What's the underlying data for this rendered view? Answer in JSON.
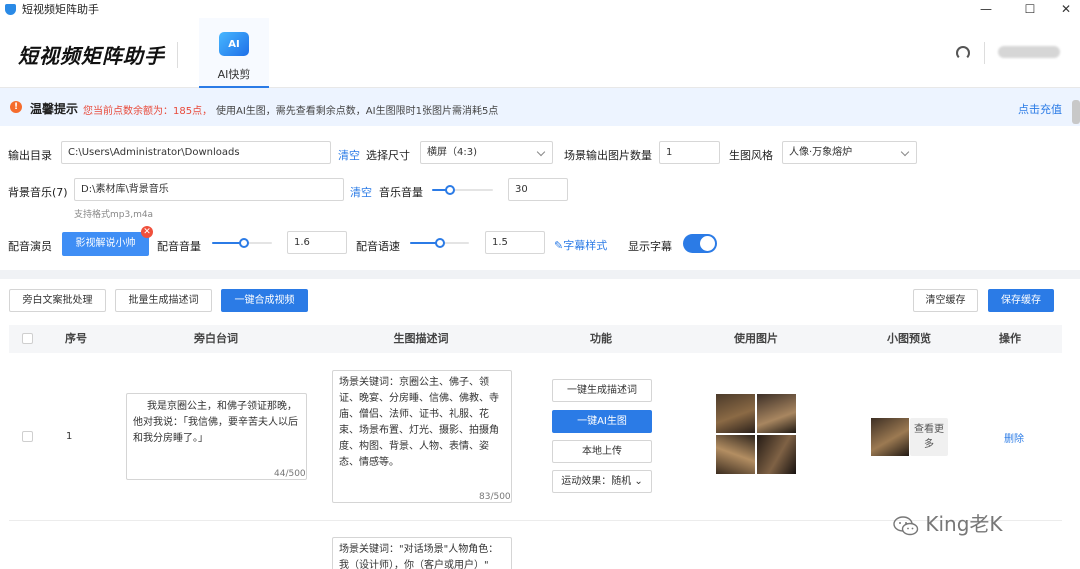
{
  "window": {
    "title": "短视频矩阵助手",
    "minimize": "—",
    "maximize": "☐",
    "close": "✕"
  },
  "header": {
    "logo": "短视频矩阵助手",
    "tab_ai_icon": "AI",
    "tab_ai_label": "AI快剪"
  },
  "notice": {
    "title": "温馨提示",
    "points": "您当前点数余额为：185点，",
    "text": "使用AI生图，需先查看剩余点数，AI生图限时1张图片需消耗5点",
    "recharge": "点击充值"
  },
  "settings": {
    "output_dir_label": "输出目录",
    "output_dir_value": "C:\\Users\\Administrator\\Downloads",
    "clear_label": "清空",
    "size_label": "选择尺寸",
    "size_value": "横屏（4:3)",
    "scene_count_label": "场景输出图片数量",
    "scene_count_value": "1",
    "style_label": "生图风格",
    "style_value": "人像·万象熔炉",
    "bgm_label": "背景音乐(7)",
    "bgm_value": "D:\\素材库\\背景音乐",
    "bgm_clear": "清空",
    "bgm_hint": "支持格式mp3,m4a",
    "music_volume_label": "音乐音量",
    "music_volume_value": "30",
    "music_volume_level": 0.3,
    "voice_actor_label": "配音演员",
    "voice_actor_value": "影视解说小帅",
    "voice_remove": "✕",
    "voice_volume_label": "配音音量",
    "voice_volume_value": "1.6",
    "voice_volume_level": 0.53,
    "voice_speed_label": "配音语速",
    "voice_speed_value": "1.5",
    "voice_speed_level": 0.5,
    "subtitle_style_link": "✎字幕样式",
    "show_subtitle_label": "显示字幕",
    "show_subtitle_on": true
  },
  "toolbar": {
    "batch_narration": "旁白文案批处理",
    "batch_describe": "批量生成描述词",
    "compose_video": "一键合成视频",
    "clear_cache": "清空缓存",
    "save_cache": "保存缓存"
  },
  "table": {
    "headers": [
      "序号",
      "旁白台词",
      "生图描述词",
      "功能",
      "使用图片",
      "小图预览",
      "操作"
    ],
    "rows": [
      {
        "index": "1",
        "narration": "我是京圈公主，和佛子领证那晚，他对我说：「我信佛，要辛苦夫人以后和我分房睡了。」",
        "narration_count": "44/500",
        "description": "场景关键词：京圈公主、佛子、领证、晚宴、分房睡、信佛、佛教、寺庙、僧侣、法师、证书、礼服、花束、场景布置、灯光、摄影、拍摄角度、构图、背景、人物、表情、姿态、情感等。",
        "description_count": "83/500",
        "fn_describe": "一键生成描述词",
        "fn_ai_image": "一键AI生图",
        "fn_upload": "本地上传",
        "fn_motion": "运动效果：随机",
        "view_more": "查看更多",
        "delete": "删除"
      },
      {
        "description": "场景关键词：\"对话场景\"人物角色：我（设计师），你（客户或用户）\""
      }
    ]
  },
  "watermark": "King老K"
}
